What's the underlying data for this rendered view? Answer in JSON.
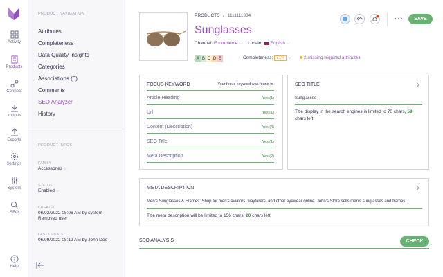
{
  "nav": {
    "items": [
      {
        "key": "activity",
        "label": "Activity"
      },
      {
        "key": "products",
        "label": "Products"
      },
      {
        "key": "connect",
        "label": "Connect"
      },
      {
        "key": "imports",
        "label": "Imports"
      },
      {
        "key": "exports",
        "label": "Exports"
      },
      {
        "key": "settings",
        "label": "Settings"
      },
      {
        "key": "system",
        "label": "System"
      },
      {
        "key": "seo",
        "label": "SEO"
      }
    ],
    "help_label": "Help"
  },
  "panel": {
    "nav_header": "PRODUCT NAVIGATION",
    "links": [
      "Attributes",
      "Completeness",
      "Data Quality Insights",
      "Categories",
      "Associations (0)",
      "Comments",
      "SEO Analyzer",
      "History"
    ],
    "active_link": "SEO Analyzer",
    "infos_header": "PRODUCT INFOS",
    "family_label": "FAMILY",
    "family_value": "Accessories",
    "status_label": "STATUS",
    "status_value": "Enabled",
    "created_label": "CREATED",
    "created_value": "06/02/2022 05:06 AM by system - Removed user",
    "update_label": "LAST UPDATE",
    "update_value": "06/09/2022 05:12 AM by John Doe"
  },
  "header": {
    "breadcrumb_lead": "PRODUCTS",
    "breadcrumb_sep": "/",
    "breadcrumb_id": "1111111304",
    "title": "Sunglasses",
    "channel_label": "Channel:",
    "channel_value": "Ecommerce",
    "locale_label": "Locale:",
    "locale_value": "English",
    "grades": [
      {
        "letter": "A",
        "color": "#b4dcb9"
      },
      {
        "letter": "B",
        "color": "#d5ebd8"
      },
      {
        "letter": "C",
        "color": "#fdf0d1"
      },
      {
        "letter": "D",
        "color": "#fcdcbb"
      },
      {
        "letter": "E",
        "color": "#f7c8c8"
      }
    ],
    "completeness_label": "Completeness:",
    "completeness_value": "71%",
    "missing_text": "2 missing required attributes",
    "more_label": "···",
    "save_label": "SAVE"
  },
  "focus": {
    "title": "FOCUS KEYWORD",
    "found_text": "Your focus keyword was found in",
    "rows": [
      {
        "label": "Article Heading",
        "result": "Yes (1)"
      },
      {
        "label": "Url",
        "result": "Yes (1)"
      },
      {
        "label": "Content (Description)",
        "result": "Yes (4)"
      },
      {
        "label": "SEO Title",
        "result": "Yes (1)"
      },
      {
        "label": "Meta Description",
        "result": "Yes (2)"
      }
    ]
  },
  "seo_title": {
    "title": "SEO TITLE",
    "value": "Sunglasses",
    "note_prefix": "Title display in the search engines is limited to 70 chars,",
    "remaining": "59",
    "note_suffix": "chars left"
  },
  "meta": {
    "title": "META DESCRIPTION",
    "value": "Men's Sunglasses & Frames: Shop for men's aviators, wayfarers, and other eyewear online. John's Store sells men's sunglasses and frames.",
    "note_prefix": "Title meta description will be limited to 156 chars,",
    "remaining": "20",
    "note_suffix": "chars left"
  },
  "analysis": {
    "title": "SEO ANALYSIS",
    "check_label": "CHECK"
  },
  "colors": {
    "accent": "#9452ba",
    "success": "#67b373",
    "warning": "#f9b53f"
  }
}
